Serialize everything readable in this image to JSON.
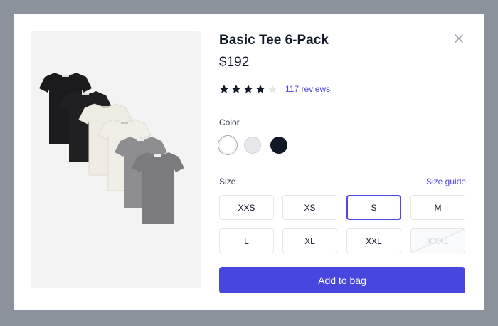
{
  "product": {
    "title": "Basic Tee 6-Pack",
    "price": "$192",
    "rating": 4,
    "rating_max": 5,
    "reviews_label": "117 reviews",
    "image_icon": "stacked-tshirts-image"
  },
  "color": {
    "label": "Color",
    "options": [
      {
        "name": "white",
        "hex": "#ffffff",
        "selected": true
      },
      {
        "name": "gray",
        "hex": "#e5e7eb",
        "selected": false
      },
      {
        "name": "black",
        "hex": "#111827",
        "selected": false
      }
    ]
  },
  "size": {
    "label": "Size",
    "guide_label": "Size guide",
    "options": [
      {
        "label": "XXS",
        "available": true,
        "selected": false
      },
      {
        "label": "XS",
        "available": true,
        "selected": false
      },
      {
        "label": "S",
        "available": true,
        "selected": true
      },
      {
        "label": "M",
        "available": true,
        "selected": false
      },
      {
        "label": "L",
        "available": true,
        "selected": false
      },
      {
        "label": "XL",
        "available": true,
        "selected": false
      },
      {
        "label": "XXL",
        "available": true,
        "selected": false
      },
      {
        "label": "XXXL",
        "available": false,
        "selected": false
      }
    ]
  },
  "actions": {
    "add_to_bag_label": "Add to bag",
    "close_icon": "close-icon"
  },
  "colors": {
    "accent": "#4f46e5",
    "button": "#4747e0",
    "overlay": "#8c929c"
  }
}
